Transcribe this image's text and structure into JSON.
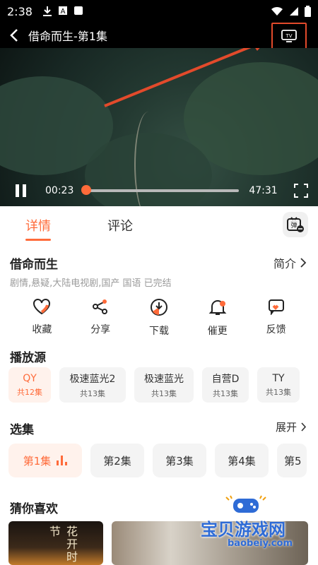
{
  "status_bar": {
    "time": "2:38",
    "icons": [
      "download-icon",
      "a-icon",
      "square-icon"
    ],
    "right_icons": [
      "wifi-icon",
      "signal-icon",
      "battery-icon"
    ]
  },
  "top_bar": {
    "title": "借命而生-第1集",
    "tv_icon_label": "TV"
  },
  "player": {
    "current_time": "00:23",
    "duration": "47:31",
    "progress": 0.01
  },
  "tabs": [
    {
      "label": "详情",
      "active": true
    },
    {
      "label": "评论",
      "active": false
    }
  ],
  "detail": {
    "show_title": "借命而生",
    "intro_label": "简介",
    "tags": "剧情,悬疑,大陆电视剧,国产 国语 已完结",
    "actions": [
      {
        "label": "收藏",
        "icon": "heart-icon"
      },
      {
        "label": "分享",
        "icon": "share-icon"
      },
      {
        "label": "下载",
        "icon": "download-icon"
      },
      {
        "label": "催更",
        "icon": "bell-icon"
      },
      {
        "label": "反馈",
        "icon": "feedback-icon"
      }
    ]
  },
  "sources": {
    "title": "播放源",
    "items": [
      {
        "name": "QY",
        "count": "共12集",
        "selected": true
      },
      {
        "name": "极速蓝光2",
        "count": "共13集",
        "selected": false
      },
      {
        "name": "极速蓝光",
        "count": "共13集",
        "selected": false
      },
      {
        "name": "自营D",
        "count": "共13集",
        "selected": false
      },
      {
        "name": "TY",
        "count": "共13集",
        "selected": false
      }
    ]
  },
  "episodes": {
    "title": "选集",
    "expand_label": "展开",
    "items": [
      {
        "label": "第1集",
        "selected": true
      },
      {
        "label": "第2集",
        "selected": false
      },
      {
        "label": "第3集",
        "selected": false
      },
      {
        "label": "第4集",
        "selected": false
      },
      {
        "label": "第5",
        "selected": false
      }
    ]
  },
  "recommend": {
    "title": "猜你喜欢",
    "thumb_text": "花开时节"
  },
  "watermark": {
    "text": "宝贝游戏网",
    "url": "baobeiy.com"
  },
  "colors": {
    "accent": "#ff6b3a",
    "annotation": "#e24a2b",
    "watermark": "#2e6bd6"
  }
}
